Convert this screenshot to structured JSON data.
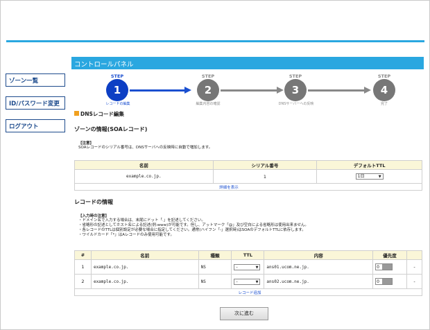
{
  "sidebar": {
    "items": [
      {
        "label": "ゾーン一覧"
      },
      {
        "label": "ID/パスワード変更"
      },
      {
        "label": "ログアウト"
      }
    ]
  },
  "panel": {
    "title": "コントロールパネル"
  },
  "steps": [
    {
      "step_word": "STEP",
      "number": "1",
      "caption": "レコードの編集",
      "active": true
    },
    {
      "step_word": "STEP",
      "number": "2",
      "caption": "編集内容の確認",
      "active": false
    },
    {
      "step_word": "STEP",
      "number": "3",
      "caption": "DNSサーバーへの反映",
      "active": false
    },
    {
      "step_word": "STEP",
      "number": "4",
      "caption": "完了",
      "active": false
    }
  ],
  "section": {
    "title": "DNSレコード編集"
  },
  "zone_info": {
    "title": "ゾーンの情報(SOAレコード)",
    "note_head": "【注意】",
    "note": "SOAレコードのシリアル番号は、DNSサーバへの反映時に自動で増加します。",
    "headers": [
      "名前",
      "シリアル番号",
      "デフォルトTTL"
    ],
    "row": {
      "name": "example.co.jp.",
      "serial": "1",
      "ttl": "1日"
    },
    "detail_link": "詳細を表示"
  },
  "record_info": {
    "title": "レコードの情報",
    "note_head": "【入力時の注意】",
    "notes": [
      "・ドメイン名で入力する場合は、末尾にドット「.」を記述してください。",
      "・省略形の記述としてホスト名による記述(例:www)が可能です。但し、アットマーク「@」及び空白による省略形は使用出来ません。",
      "・各レコードのTTLは個別設定が必要な場合に指定してください。通常(ハイフン「-」選択時)はSOAのデフォルトTTLに依存します。",
      "・ワイルドカード「*」はAレコードのみ使用可能です。"
    ],
    "headers": [
      "#",
      "名前",
      "種類",
      "TTL",
      "内容",
      "優先度"
    ],
    "rows": [
      {
        "num": "1",
        "name": "example.co.jp.",
        "type": "NS",
        "ttl": "-",
        "content": "ans01.ucom.ne.jp.",
        "priority": "0",
        "action": "-"
      },
      {
        "num": "2",
        "name": "example.co.jp.",
        "type": "NS",
        "ttl": "-",
        "content": "ans02.ucom.ne.jp.",
        "priority": "0",
        "action": "-"
      }
    ],
    "add_link": "レコード追加"
  },
  "next_button": {
    "label": "次に進む"
  }
}
